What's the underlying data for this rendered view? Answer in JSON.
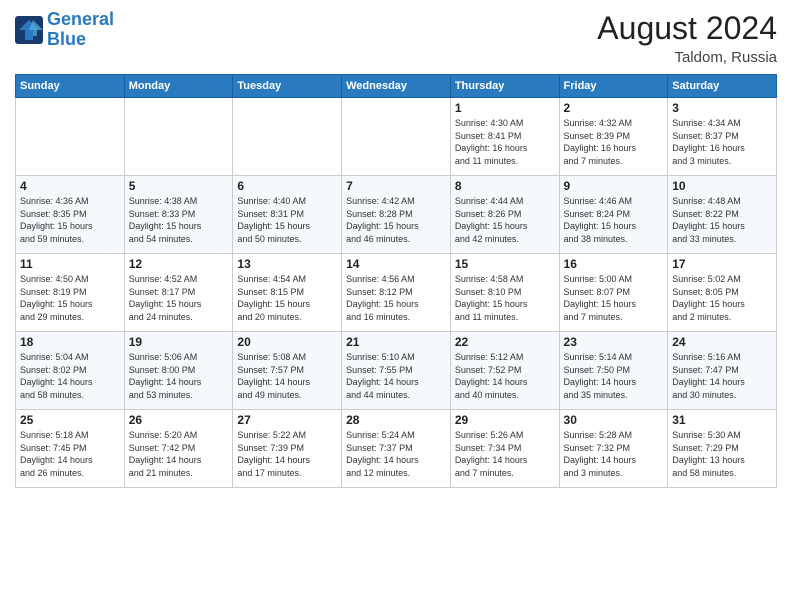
{
  "header": {
    "logo_line1": "General",
    "logo_line2": "Blue",
    "month_year": "August 2024",
    "location": "Taldom, Russia"
  },
  "weekdays": [
    "Sunday",
    "Monday",
    "Tuesday",
    "Wednesday",
    "Thursday",
    "Friday",
    "Saturday"
  ],
  "weeks": [
    [
      {
        "day": "",
        "info": ""
      },
      {
        "day": "",
        "info": ""
      },
      {
        "day": "",
        "info": ""
      },
      {
        "day": "",
        "info": ""
      },
      {
        "day": "1",
        "info": "Sunrise: 4:30 AM\nSunset: 8:41 PM\nDaylight: 16 hours\nand 11 minutes."
      },
      {
        "day": "2",
        "info": "Sunrise: 4:32 AM\nSunset: 8:39 PM\nDaylight: 16 hours\nand 7 minutes."
      },
      {
        "day": "3",
        "info": "Sunrise: 4:34 AM\nSunset: 8:37 PM\nDaylight: 16 hours\nand 3 minutes."
      }
    ],
    [
      {
        "day": "4",
        "info": "Sunrise: 4:36 AM\nSunset: 8:35 PM\nDaylight: 15 hours\nand 59 minutes."
      },
      {
        "day": "5",
        "info": "Sunrise: 4:38 AM\nSunset: 8:33 PM\nDaylight: 15 hours\nand 54 minutes."
      },
      {
        "day": "6",
        "info": "Sunrise: 4:40 AM\nSunset: 8:31 PM\nDaylight: 15 hours\nand 50 minutes."
      },
      {
        "day": "7",
        "info": "Sunrise: 4:42 AM\nSunset: 8:28 PM\nDaylight: 15 hours\nand 46 minutes."
      },
      {
        "day": "8",
        "info": "Sunrise: 4:44 AM\nSunset: 8:26 PM\nDaylight: 15 hours\nand 42 minutes."
      },
      {
        "day": "9",
        "info": "Sunrise: 4:46 AM\nSunset: 8:24 PM\nDaylight: 15 hours\nand 38 minutes."
      },
      {
        "day": "10",
        "info": "Sunrise: 4:48 AM\nSunset: 8:22 PM\nDaylight: 15 hours\nand 33 minutes."
      }
    ],
    [
      {
        "day": "11",
        "info": "Sunrise: 4:50 AM\nSunset: 8:19 PM\nDaylight: 15 hours\nand 29 minutes."
      },
      {
        "day": "12",
        "info": "Sunrise: 4:52 AM\nSunset: 8:17 PM\nDaylight: 15 hours\nand 24 minutes."
      },
      {
        "day": "13",
        "info": "Sunrise: 4:54 AM\nSunset: 8:15 PM\nDaylight: 15 hours\nand 20 minutes."
      },
      {
        "day": "14",
        "info": "Sunrise: 4:56 AM\nSunset: 8:12 PM\nDaylight: 15 hours\nand 16 minutes."
      },
      {
        "day": "15",
        "info": "Sunrise: 4:58 AM\nSunset: 8:10 PM\nDaylight: 15 hours\nand 11 minutes."
      },
      {
        "day": "16",
        "info": "Sunrise: 5:00 AM\nSunset: 8:07 PM\nDaylight: 15 hours\nand 7 minutes."
      },
      {
        "day": "17",
        "info": "Sunrise: 5:02 AM\nSunset: 8:05 PM\nDaylight: 15 hours\nand 2 minutes."
      }
    ],
    [
      {
        "day": "18",
        "info": "Sunrise: 5:04 AM\nSunset: 8:02 PM\nDaylight: 14 hours\nand 58 minutes."
      },
      {
        "day": "19",
        "info": "Sunrise: 5:06 AM\nSunset: 8:00 PM\nDaylight: 14 hours\nand 53 minutes."
      },
      {
        "day": "20",
        "info": "Sunrise: 5:08 AM\nSunset: 7:57 PM\nDaylight: 14 hours\nand 49 minutes."
      },
      {
        "day": "21",
        "info": "Sunrise: 5:10 AM\nSunset: 7:55 PM\nDaylight: 14 hours\nand 44 minutes."
      },
      {
        "day": "22",
        "info": "Sunrise: 5:12 AM\nSunset: 7:52 PM\nDaylight: 14 hours\nand 40 minutes."
      },
      {
        "day": "23",
        "info": "Sunrise: 5:14 AM\nSunset: 7:50 PM\nDaylight: 14 hours\nand 35 minutes."
      },
      {
        "day": "24",
        "info": "Sunrise: 5:16 AM\nSunset: 7:47 PM\nDaylight: 14 hours\nand 30 minutes."
      }
    ],
    [
      {
        "day": "25",
        "info": "Sunrise: 5:18 AM\nSunset: 7:45 PM\nDaylight: 14 hours\nand 26 minutes."
      },
      {
        "day": "26",
        "info": "Sunrise: 5:20 AM\nSunset: 7:42 PM\nDaylight: 14 hours\nand 21 minutes."
      },
      {
        "day": "27",
        "info": "Sunrise: 5:22 AM\nSunset: 7:39 PM\nDaylight: 14 hours\nand 17 minutes."
      },
      {
        "day": "28",
        "info": "Sunrise: 5:24 AM\nSunset: 7:37 PM\nDaylight: 14 hours\nand 12 minutes."
      },
      {
        "day": "29",
        "info": "Sunrise: 5:26 AM\nSunset: 7:34 PM\nDaylight: 14 hours\nand 7 minutes."
      },
      {
        "day": "30",
        "info": "Sunrise: 5:28 AM\nSunset: 7:32 PM\nDaylight: 14 hours\nand 3 minutes."
      },
      {
        "day": "31",
        "info": "Sunrise: 5:30 AM\nSunset: 7:29 PM\nDaylight: 13 hours\nand 58 minutes."
      }
    ]
  ]
}
